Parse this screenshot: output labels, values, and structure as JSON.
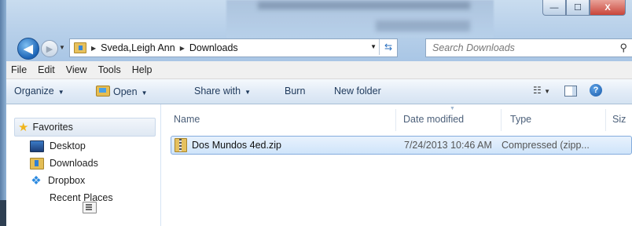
{
  "window": {
    "caption_buttons": {
      "minimize": "—",
      "maximize": "☐",
      "close": "X"
    }
  },
  "address": {
    "crumbs": [
      "Sveda,Leigh Ann",
      "Downloads"
    ]
  },
  "search": {
    "placeholder": "Search Downloads"
  },
  "menu": [
    "File",
    "Edit",
    "View",
    "Tools",
    "Help"
  ],
  "toolbar": {
    "organize": "Organize",
    "open": "Open",
    "share_with": "Share with",
    "burn": "Burn",
    "new_folder": "New folder"
  },
  "sidebar": {
    "favorites": "Favorites",
    "items": [
      "Desktop",
      "Downloads",
      "Dropbox",
      "Recent Places"
    ]
  },
  "columns": {
    "name": "Name",
    "date": "Date modified",
    "type": "Type",
    "size": "Siz"
  },
  "files": [
    {
      "name": "Dos Mundos 4ed.zip",
      "date": "7/24/2013 10:46 AM",
      "type": "Compressed (zipp..."
    }
  ]
}
